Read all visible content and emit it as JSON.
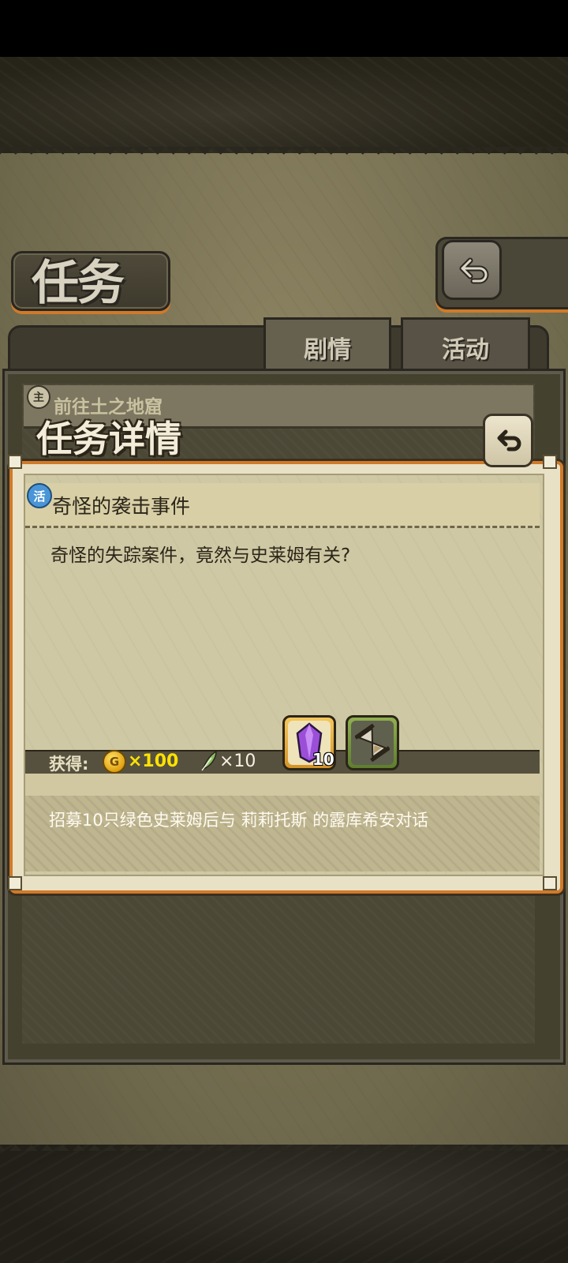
{
  "header": {
    "title": "任务"
  },
  "tabs": [
    {
      "label": "剧情",
      "active": true
    },
    {
      "label": "活动",
      "active": false
    }
  ],
  "quest_list": {
    "row_icon": "主",
    "row_text": "前往土之地窟"
  },
  "detail": {
    "title": "任务详情",
    "quest_tag": "活",
    "quest_name": "奇怪的袭击事件",
    "description": "奇怪的失踪案件，竟然与史莱姆有关?",
    "reward_label": "获得:",
    "rewards": {
      "coin_symbol": "G",
      "coin_amount": "×100",
      "feather_amount": "×10",
      "crystal_count": "10"
    },
    "condition": "招募10只绿色史莱姆后与 莉莉托斯 的露库希安对话"
  },
  "icons": [
    "back-arrow-icon",
    "coin-icon",
    "feather-icon",
    "crystal-icon",
    "hourglass-icon"
  ],
  "colors": {
    "accent_orange": "#d07a2a",
    "coin_text": "#ffe200",
    "parchment": "#e9e1c5"
  }
}
